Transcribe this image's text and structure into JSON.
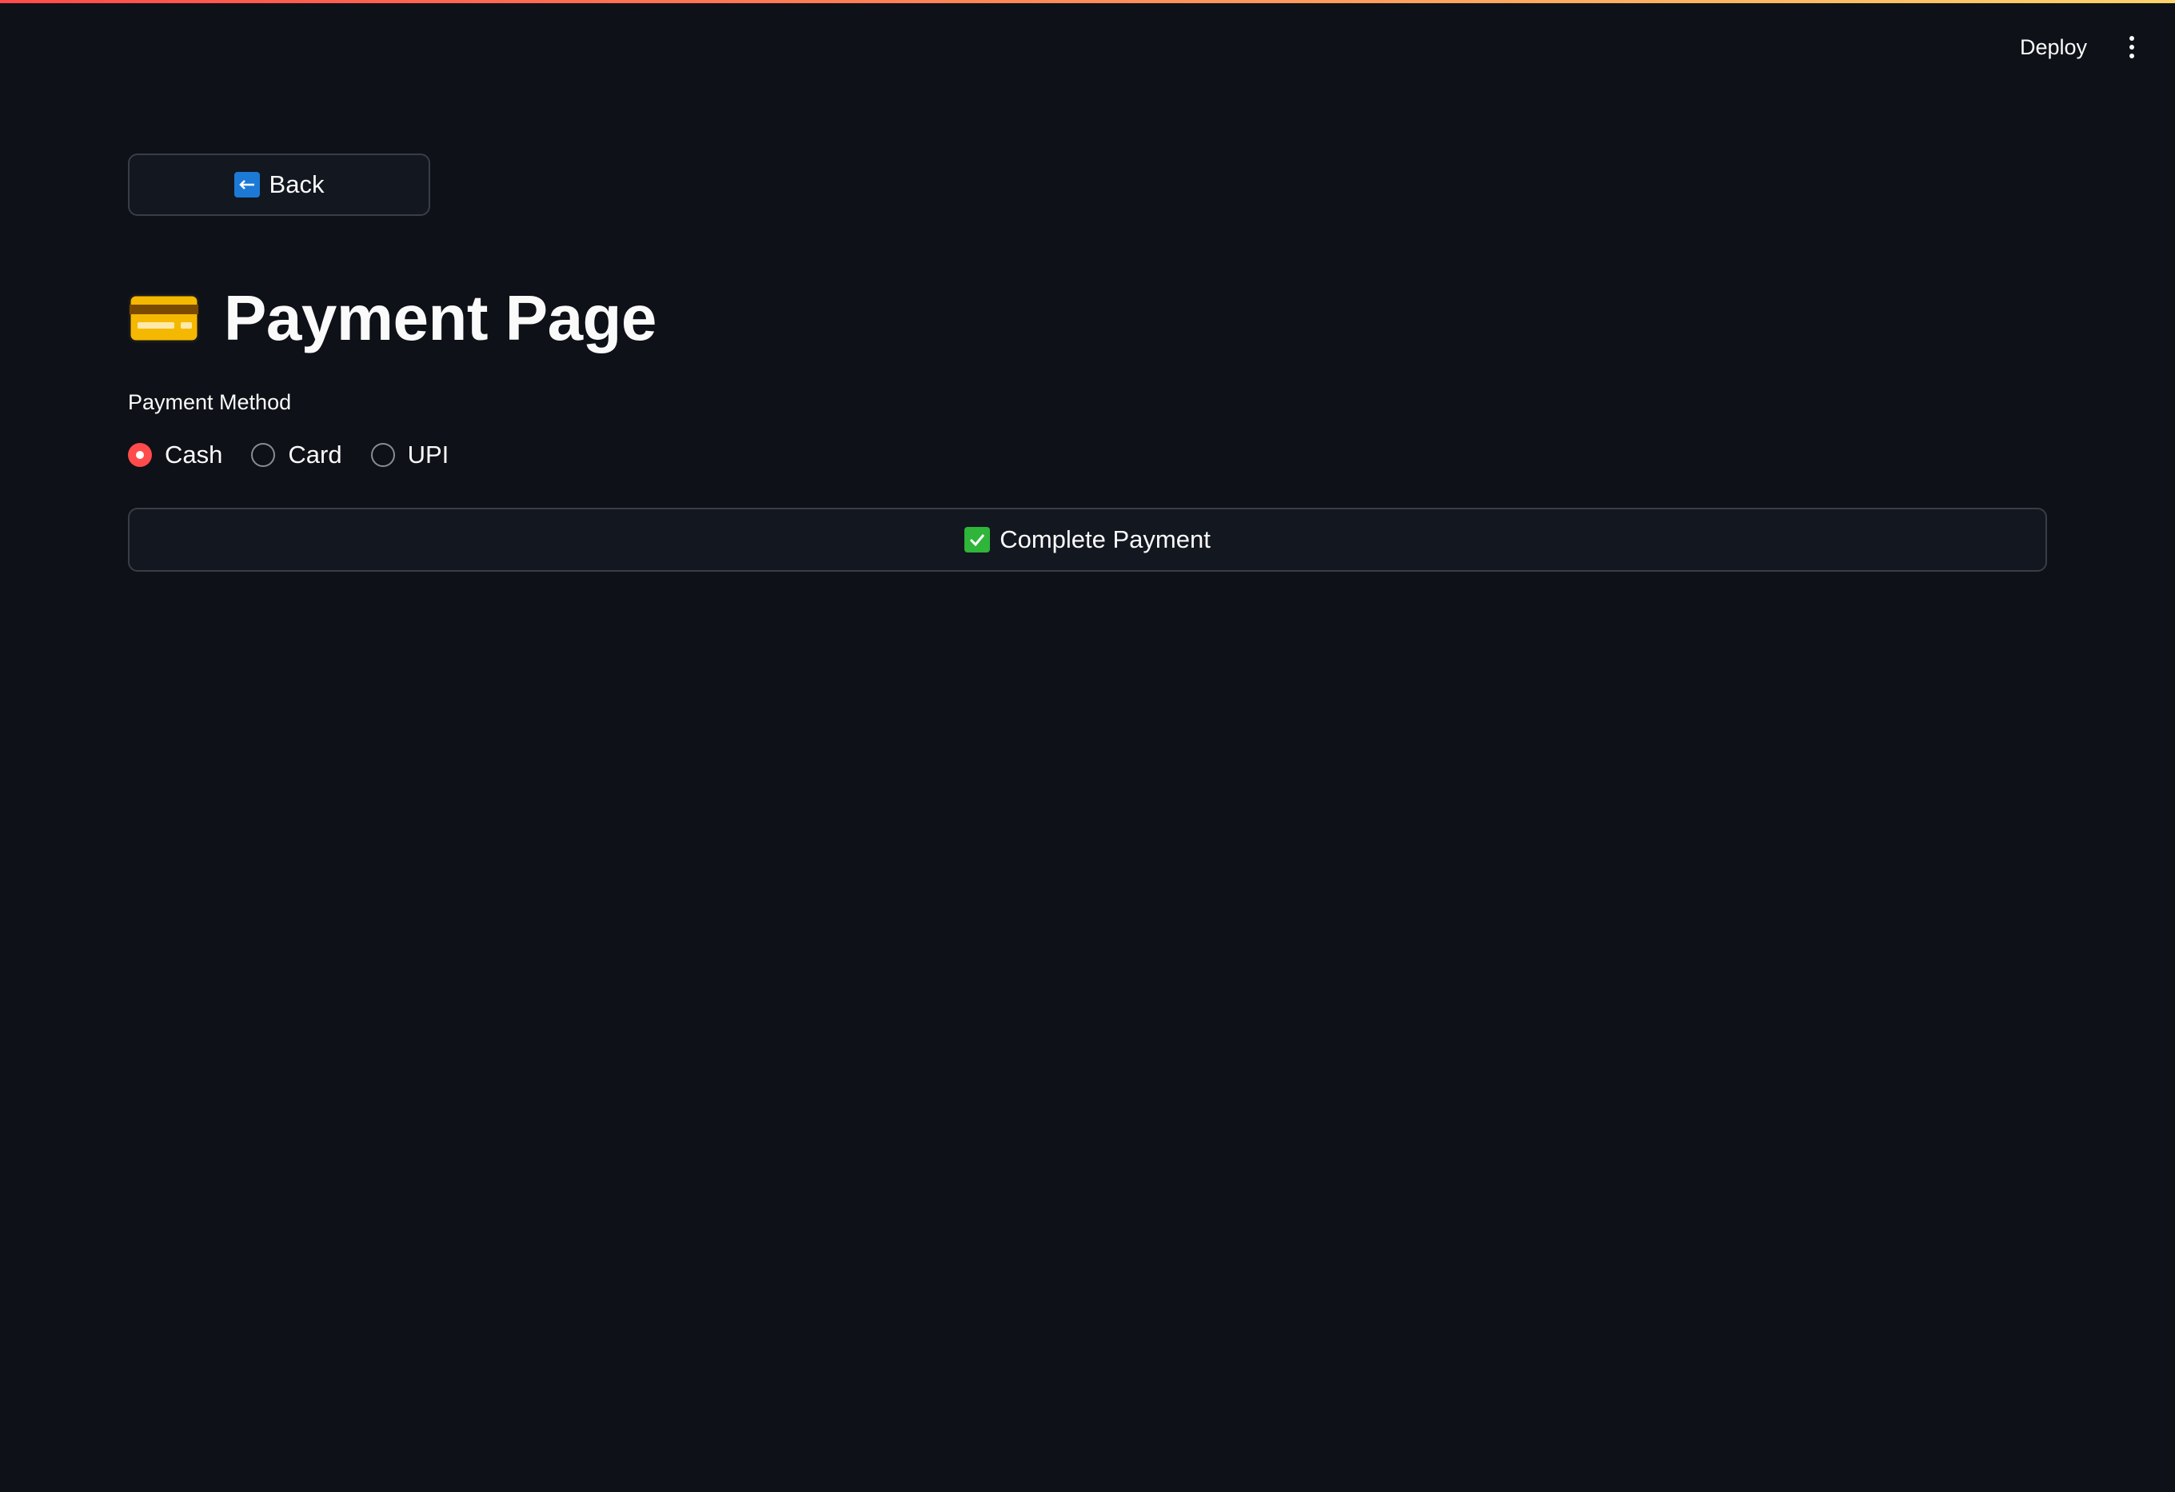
{
  "header": {
    "deploy_label": "Deploy",
    "menu_icon": "kebab-menu-icon"
  },
  "back_button": {
    "icon": "left-arrow-icon",
    "label": "Back"
  },
  "page": {
    "title_icon": "credit-card-icon",
    "title": "Payment Page"
  },
  "payment_method": {
    "label": "Payment Method",
    "options": [
      {
        "label": "Cash",
        "selected": true
      },
      {
        "label": "Card",
        "selected": false
      },
      {
        "label": "UPI",
        "selected": false
      }
    ]
  },
  "complete_button": {
    "icon": "check-mark-icon",
    "label": "Complete Payment"
  },
  "colors": {
    "background": "#0e1117",
    "accent": "#ff4b4b",
    "button_bg": "#131720",
    "button_border": "#3a3d46",
    "text": "#fafafa"
  }
}
